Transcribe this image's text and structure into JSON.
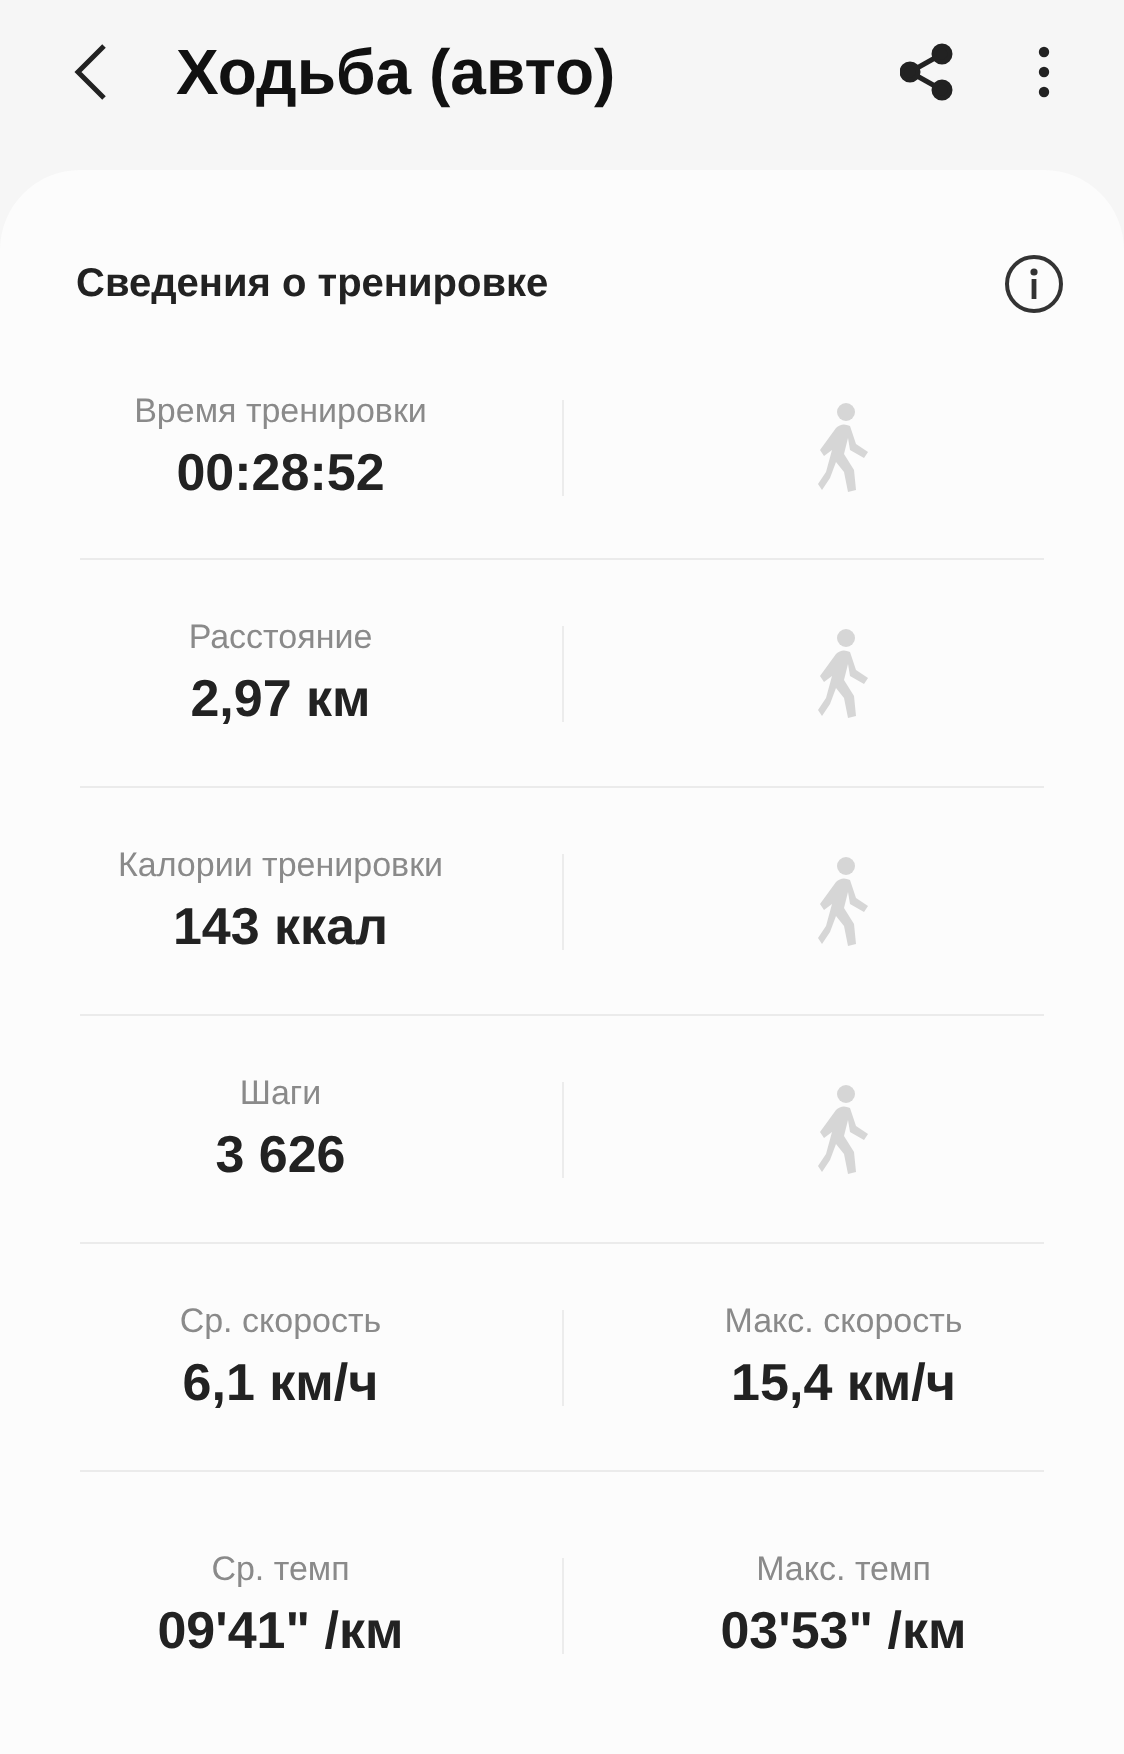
{
  "header": {
    "title": "Ходьба (авто)"
  },
  "card": {
    "title": "Сведения о тренировке",
    "rows": [
      {
        "left": {
          "label": "Время тренировки",
          "value": "00:28:52"
        },
        "right": {
          "kind": "icon"
        }
      },
      {
        "left": {
          "label": "Расстояние",
          "value": "2,97 км"
        },
        "right": {
          "kind": "icon"
        }
      },
      {
        "left": {
          "label": "Калории тренировки",
          "value": "143 ккал"
        },
        "right": {
          "kind": "icon"
        }
      },
      {
        "left": {
          "label": "Шаги",
          "value": "3 626"
        },
        "right": {
          "kind": "icon"
        }
      },
      {
        "left": {
          "label": "Ср. скорость",
          "value": "6,1 км/ч"
        },
        "right": {
          "kind": "stat",
          "label": "Макс. скорость",
          "value": "15,4 км/ч"
        }
      },
      {
        "left": {
          "label": "Ср. темп",
          "value": "09'41\" /км"
        },
        "right": {
          "kind": "stat",
          "label": "Макс. темп",
          "value": "03'53\" /км"
        }
      }
    ]
  }
}
